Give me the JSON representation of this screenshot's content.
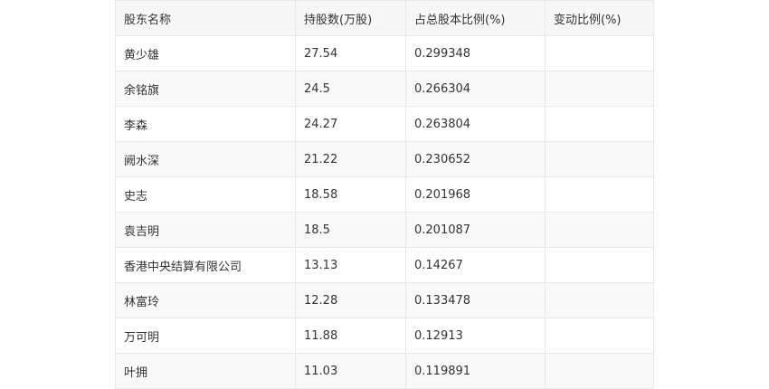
{
  "table": {
    "headers": [
      "股东名称",
      "持股数(万股)",
      "占总股本比例(%)",
      "变动比例(%)"
    ],
    "rows": [
      {
        "name": "黄少雄",
        "shares": "27.54",
        "ratio": "0.299348",
        "change": ""
      },
      {
        "name": "余铭旗",
        "shares": "24.5",
        "ratio": "0.266304",
        "change": ""
      },
      {
        "name": "李森",
        "shares": "24.27",
        "ratio": "0.263804",
        "change": ""
      },
      {
        "name": "阙水深",
        "shares": "21.22",
        "ratio": "0.230652",
        "change": ""
      },
      {
        "name": "史志",
        "shares": "18.58",
        "ratio": "0.201968",
        "change": ""
      },
      {
        "name": "袁吉明",
        "shares": "18.5",
        "ratio": "0.201087",
        "change": ""
      },
      {
        "name": "香港中央结算有限公司",
        "shares": "13.13",
        "ratio": "0.14267",
        "change": ""
      },
      {
        "name": "林富玲",
        "shares": "12.28",
        "ratio": "0.133478",
        "change": ""
      },
      {
        "name": "万可明",
        "shares": "11.88",
        "ratio": "0.12913",
        "change": ""
      },
      {
        "name": "叶拥",
        "shares": "11.03",
        "ratio": "0.119891",
        "change": ""
      }
    ]
  }
}
